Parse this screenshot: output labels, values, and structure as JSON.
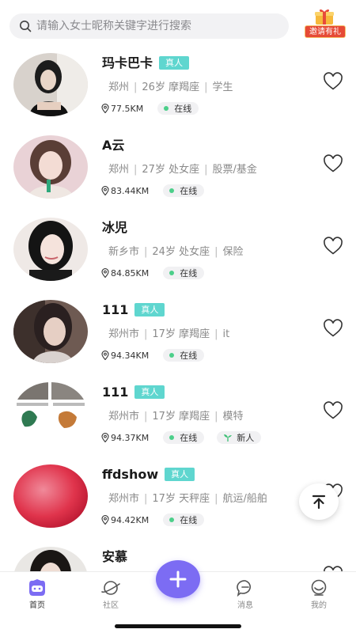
{
  "search": {
    "placeholder": "请输入女士昵称关键字进行搜索",
    "icon": "search-icon"
  },
  "invite": {
    "label": "邀请有礼",
    "icon": "gift-icon"
  },
  "users": [
    {
      "name": "玛卡巴卡",
      "verified": "真人",
      "city": "郑州",
      "age": "26岁",
      "zodiac": "摩羯座",
      "job": "学生",
      "distance": "77.5KM",
      "status": "在线"
    },
    {
      "name": "A云",
      "city": "郑州",
      "age": "27岁",
      "zodiac": "处女座",
      "job": "股票/基金",
      "distance": "83.44KM",
      "status": "在线"
    },
    {
      "name": "冰児",
      "city": "新乡市",
      "age": "24岁",
      "zodiac": "处女座",
      "job": "保险",
      "distance": "84.85KM",
      "status": "在线"
    },
    {
      "name": "111",
      "verified": "真人",
      "city": "郑州市",
      "age": "17岁",
      "zodiac": "摩羯座",
      "job": "it",
      "distance": "94.34KM",
      "status": "在线"
    },
    {
      "name": "111",
      "verified": "真人",
      "city": "郑州市",
      "age": "17岁",
      "zodiac": "摩羯座",
      "job": "模特",
      "distance": "94.37KM",
      "status": "在线",
      "badge": "新人"
    },
    {
      "name": "ffdshow",
      "verified": "真人",
      "city": "郑州市",
      "age": "17岁",
      "zodiac": "天秤座",
      "job": "航运/船舶",
      "distance": "94.42KM",
      "status": "在线"
    },
    {
      "name": "安慕"
    }
  ],
  "tabs": [
    {
      "label": "首页",
      "icon": "home-face-icon",
      "active": true
    },
    {
      "label": "社区",
      "icon": "planet-icon"
    },
    {
      "label": "消息",
      "icon": "chat-bubble-icon"
    },
    {
      "label": "我的",
      "icon": "profile-face-icon"
    }
  ],
  "colors": {
    "accent": "#7c6cf3",
    "verified": "#5fd6cf",
    "online_dot": "#4ccf8a",
    "invite_red": "#e64a36"
  }
}
